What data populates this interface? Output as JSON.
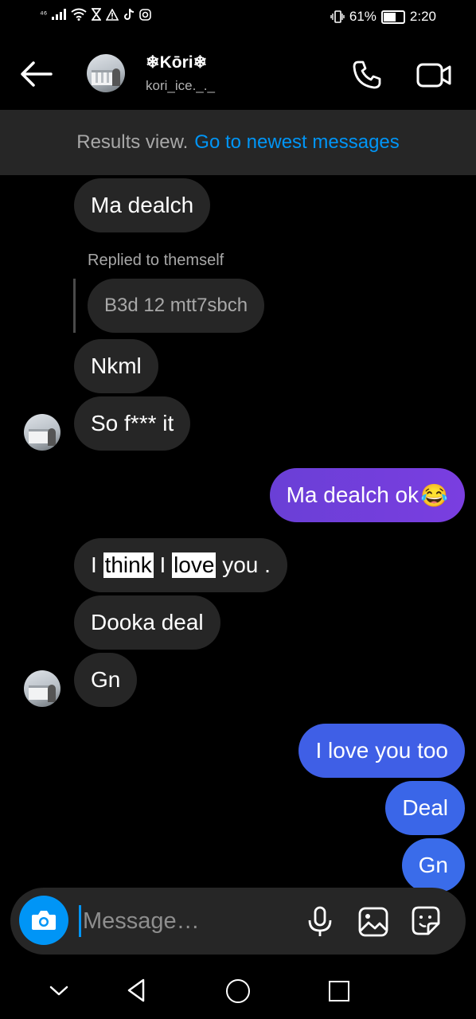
{
  "status": {
    "network": "⁴⁶",
    "battery": "61%",
    "time": "2:20"
  },
  "header": {
    "name": "❄Kōri❄",
    "handle": "kori_ice._._"
  },
  "banner": {
    "muted": "Results view.",
    "link": "Go to newest messages"
  },
  "messages": {
    "m1": "Ma dealch",
    "reply_label": "Replied to themself",
    "reply_quote": "B3d 12 mtt7sbch",
    "m2": "Nkml",
    "m3": "So f*** it",
    "out1_text": "Ma dealch ok",
    "out1_emoji": "😂",
    "m4_a": "I ",
    "m4_think": "think",
    "m4_b": " I ",
    "m4_love": "love",
    "m4_c": " you .",
    "m5": "Dooka deal",
    "m6": "Gn",
    "out2": "I love you too",
    "out3": "Deal",
    "out4": "Gn"
  },
  "composer": {
    "placeholder": "Message…"
  },
  "colors": {
    "accent": "#0095f6",
    "incoming_bubble": "#262626",
    "outgoing_purple": "#6d3ad8",
    "outgoing_blue": "#3a63e6"
  }
}
